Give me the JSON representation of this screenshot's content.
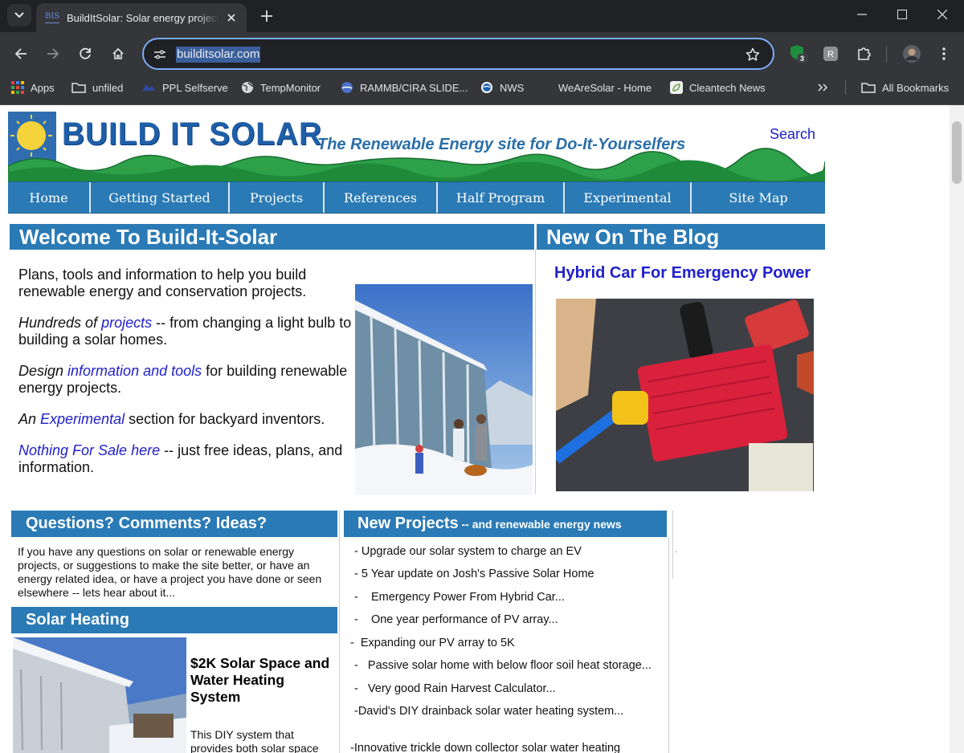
{
  "browser": {
    "tab_title": "BuildItSolar: Solar energy projects",
    "url": "builditsolar.com",
    "extension_badge": "3",
    "bookmarks": [
      "Apps",
      "unfiled",
      "PPL Selfserve",
      "TempMonitor",
      "RAMMB/CIRA SLIDE...",
      "NWS",
      "WeAreSolar - Home",
      "Cleantech News"
    ],
    "all_bookmarks": "All Bookmarks"
  },
  "header": {
    "logo": "BUILD IT SOLAR",
    "tagline": "The Renewable Energy site for Do-It-Yourselfers",
    "search": "Search"
  },
  "nav": [
    "Home",
    "Getting Started",
    "Projects",
    "References",
    "Half Program",
    "Experimental",
    "Site Map"
  ],
  "welcome": {
    "heading": "Welcome To Build-It-Solar",
    "p1": "Plans, tools and information  to help you build renewable energy and conservation projects.",
    "p2_a": "Hundreds of ",
    "p2_link": "projects",
    "p2_b": " -- from changing a light bulb to building a solar homes.",
    "p3_a": "Design ",
    "p3_link": "information and tools",
    "p3_b": "  for building renewable energy projects.",
    "p4_a": "An ",
    "p4_link": "Experimental",
    "p4_b": " section for backyard inventors.",
    "p5_link": "Nothing For Sale here",
    "p5_b": " -- just free ideas, plans, and information."
  },
  "blog": {
    "heading": "New On The Blog",
    "post_title": "Hybrid Car For Emergency Power"
  },
  "questions": {
    "heading": "Questions? Comments? Ideas?",
    "text": " If you have any questions on solar or renewable energy projects, or suggestions to make the site better, or have an energy related idea, or have a project you have done or seen elsewhere -- lets hear about it..."
  },
  "solar_heating": {
    "heading": "Solar Heating",
    "title": "$2K Solar Space and Water Heating System",
    "text": "This DIY system that provides both solar space"
  },
  "new_projects": {
    "heading": "New Projects",
    "subheading": " -- and renewable energy news",
    "items": [
      "- Upgrade our solar system to charge an EV",
      "- 5 Year update on Josh's Passive Solar Home",
      "-    Emergency Power From Hybrid Car...",
      "-    One year performance of PV array...",
      "-  Expanding our PV array to 5K",
      "-   Passive solar home with below floor soil heat storage...",
      "-   Very good Rain Harvest Calculator...",
      "-David's DIY drainback solar water heating system...",
      "-Innovative trickle down collector solar water heating"
    ]
  },
  "colors": {
    "nav_blue": "#2a7ab5",
    "link": "#2020cc",
    "omnibox_border": "#7cacf8"
  }
}
